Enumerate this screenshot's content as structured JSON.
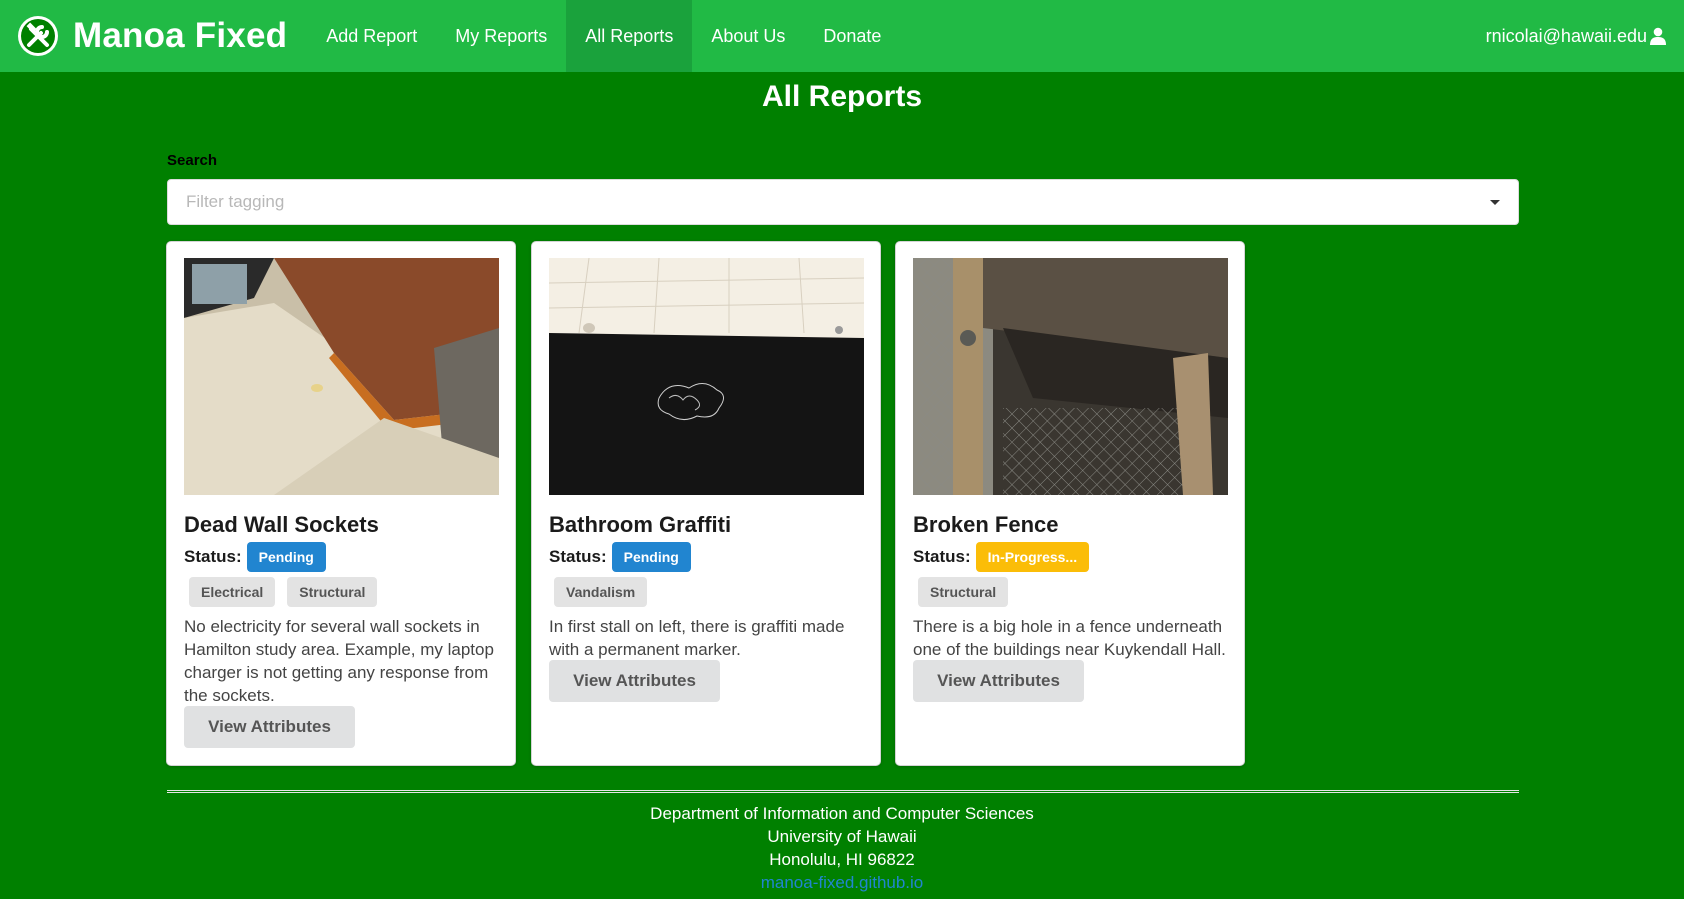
{
  "nav": {
    "brand": "Manoa Fixed",
    "items": [
      {
        "label": "Add Report"
      },
      {
        "label": "My Reports"
      },
      {
        "label": "All Reports"
      },
      {
        "label": "About Us"
      },
      {
        "label": "Donate"
      }
    ],
    "active": "All Reports",
    "user_email": "rnicolai@hawaii.edu",
    "color": "#21ba45"
  },
  "page": {
    "title": "All Reports",
    "background": "#008000"
  },
  "search": {
    "label": "Search",
    "placeholder": "Filter tagging"
  },
  "cards": [
    {
      "title": "Dead Wall Sockets",
      "status_label": "Status:",
      "status": "Pending",
      "status_color": "#2185d0",
      "tags": [
        "Electrical",
        "Structural"
      ],
      "description": "No electricity for several wall sockets in Hamilton study area. Example, my laptop charger is not getting any response from the sockets.",
      "button": "View Attributes"
    },
    {
      "title": "Bathroom Graffiti",
      "status_label": "Status:",
      "status": "Pending",
      "status_color": "#2185d0",
      "tags": [
        "Vandalism"
      ],
      "description": "In first stall on left, there is graffiti made with a permanent marker.",
      "button": "View Attributes"
    },
    {
      "title": "Broken Fence",
      "status_label": "Status:",
      "status": "In-Progress...",
      "status_color": "#fbbd08",
      "tags": [
        "Structural"
      ],
      "description": "There is a big hole in a fence underneath one of the buildings near Kuykendall Hall.",
      "button": "View Attributes"
    }
  ],
  "footer": {
    "line1": "Department of Information and Computer Sciences",
    "line2": "University of Hawaii",
    "line3": "Honolulu, HI 96822",
    "link": "manoa-fixed.github.io"
  }
}
